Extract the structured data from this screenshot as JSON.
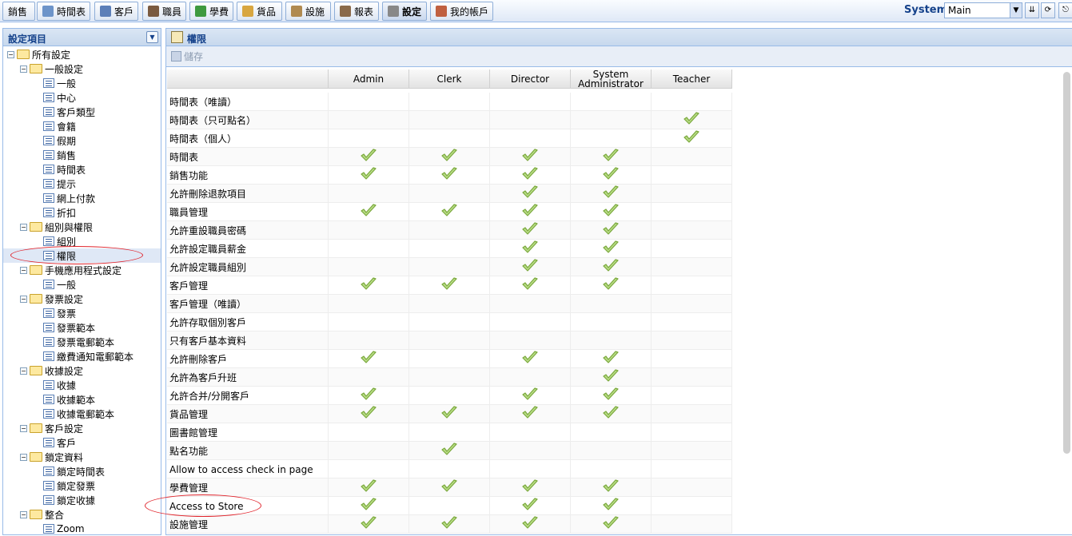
{
  "toolbar": {
    "tabs": [
      {
        "label": "銷售",
        "icon": "sales-icon"
      },
      {
        "label": "時間表",
        "icon": "calendar-icon"
      },
      {
        "label": "客戶",
        "icon": "user-icon"
      },
      {
        "label": "職員",
        "icon": "staff-icon"
      },
      {
        "label": "學費",
        "icon": "dollar-icon"
      },
      {
        "label": "貨品",
        "icon": "box-icon"
      },
      {
        "label": "設施",
        "icon": "house-icon"
      },
      {
        "label": "報表",
        "icon": "report-icon"
      },
      {
        "label": "設定",
        "icon": "gear-icon"
      },
      {
        "label": "我的帳戶",
        "icon": "account-icon"
      }
    ],
    "system_label": "System",
    "system_value": "Main"
  },
  "left": {
    "title": "設定項目",
    "tree": [
      {
        "label": "所有設定",
        "type": "folder",
        "level": 0
      },
      {
        "label": "一般設定",
        "type": "folder",
        "level": 1
      },
      {
        "label": "一般",
        "type": "leaf",
        "level": 2
      },
      {
        "label": "中心",
        "type": "leaf",
        "level": 2
      },
      {
        "label": "客戶類型",
        "type": "leaf",
        "level": 2
      },
      {
        "label": "會籍",
        "type": "leaf",
        "level": 2
      },
      {
        "label": "假期",
        "type": "leaf",
        "level": 2
      },
      {
        "label": "銷售",
        "type": "leaf",
        "level": 2
      },
      {
        "label": "時間表",
        "type": "leaf",
        "level": 2
      },
      {
        "label": "提示",
        "type": "leaf",
        "level": 2
      },
      {
        "label": "網上付款",
        "type": "leaf",
        "level": 2
      },
      {
        "label": "折扣",
        "type": "leaf",
        "level": 2
      },
      {
        "label": "組別與權限",
        "type": "folder",
        "level": 1
      },
      {
        "label": "組別",
        "type": "leaf",
        "level": 2
      },
      {
        "label": "權限",
        "type": "leaf",
        "level": 2,
        "selected": true
      },
      {
        "label": "手機應用程式設定",
        "type": "folder",
        "level": 1
      },
      {
        "label": "一般",
        "type": "leaf",
        "level": 2
      },
      {
        "label": "發票設定",
        "type": "folder",
        "level": 1
      },
      {
        "label": "發票",
        "type": "leaf",
        "level": 2
      },
      {
        "label": "發票範本",
        "type": "leaf",
        "level": 2
      },
      {
        "label": "發票電郵範本",
        "type": "leaf",
        "level": 2
      },
      {
        "label": "繳費通知電郵範本",
        "type": "leaf",
        "level": 2
      },
      {
        "label": "收據設定",
        "type": "folder",
        "level": 1
      },
      {
        "label": "收據",
        "type": "leaf",
        "level": 2
      },
      {
        "label": "收據範本",
        "type": "leaf",
        "level": 2
      },
      {
        "label": "收據電郵範本",
        "type": "leaf",
        "level": 2
      },
      {
        "label": "客戶設定",
        "type": "folder",
        "level": 1
      },
      {
        "label": "客戶",
        "type": "leaf",
        "level": 2
      },
      {
        "label": "鎖定資料",
        "type": "folder",
        "level": 1
      },
      {
        "label": "鎖定時間表",
        "type": "leaf",
        "level": 2
      },
      {
        "label": "鎖定發票",
        "type": "leaf",
        "level": 2
      },
      {
        "label": "鎖定收據",
        "type": "leaf",
        "level": 2
      },
      {
        "label": "整合",
        "type": "folder",
        "level": 1
      },
      {
        "label": "Zoom",
        "type": "leaf",
        "level": 2
      }
    ]
  },
  "right": {
    "title": "權限",
    "save_label": "儲存",
    "columns": [
      "Admin",
      "Clerk",
      "Director",
      "System\nAdministrator",
      "Teacher"
    ],
    "rows": [
      {
        "label": "時間表（唯讀）",
        "checks": [
          0,
          0,
          0,
          0,
          0
        ]
      },
      {
        "label": "時間表（只可點名）",
        "checks": [
          0,
          0,
          0,
          0,
          1
        ]
      },
      {
        "label": "時間表（個人）",
        "checks": [
          0,
          0,
          0,
          0,
          1
        ]
      },
      {
        "label": "時間表",
        "checks": [
          1,
          1,
          1,
          1,
          0
        ]
      },
      {
        "label": "銷售功能",
        "checks": [
          1,
          1,
          1,
          1,
          0
        ]
      },
      {
        "label": "允許刪除退款項目",
        "checks": [
          0,
          0,
          1,
          1,
          0
        ]
      },
      {
        "label": "職員管理",
        "checks": [
          1,
          1,
          1,
          1,
          0
        ]
      },
      {
        "label": "允許重設職員密碼",
        "checks": [
          0,
          0,
          1,
          1,
          0
        ]
      },
      {
        "label": "允許設定職員薪金",
        "checks": [
          0,
          0,
          1,
          1,
          0
        ]
      },
      {
        "label": "允許設定職員組別",
        "checks": [
          0,
          0,
          1,
          1,
          0
        ]
      },
      {
        "label": "客戶管理",
        "checks": [
          1,
          1,
          1,
          1,
          0
        ]
      },
      {
        "label": "客戶管理（唯讀）",
        "checks": [
          0,
          0,
          0,
          0,
          0
        ]
      },
      {
        "label": "允許存取個別客戶",
        "checks": [
          0,
          0,
          0,
          0,
          0
        ]
      },
      {
        "label": "只有客戶基本資料",
        "checks": [
          0,
          0,
          0,
          0,
          0
        ]
      },
      {
        "label": "允許刪除客戶",
        "checks": [
          1,
          0,
          1,
          1,
          0
        ]
      },
      {
        "label": "允許為客戶升班",
        "checks": [
          0,
          0,
          0,
          1,
          0
        ]
      },
      {
        "label": "允許合并/分開客戶",
        "checks": [
          1,
          0,
          1,
          1,
          0
        ]
      },
      {
        "label": "貨品管理",
        "checks": [
          1,
          1,
          1,
          1,
          0
        ]
      },
      {
        "label": "圖書館管理",
        "checks": [
          0,
          0,
          0,
          0,
          0
        ]
      },
      {
        "label": "點名功能",
        "checks": [
          0,
          1,
          0,
          0,
          0
        ]
      },
      {
        "label": "Allow to access check in page",
        "checks": [
          0,
          0,
          0,
          0,
          0
        ]
      },
      {
        "label": "學費管理",
        "checks": [
          1,
          1,
          1,
          1,
          0
        ]
      },
      {
        "label": "Access to Store",
        "checks": [
          1,
          0,
          1,
          1,
          0
        ]
      },
      {
        "label": "設施管理",
        "checks": [
          1,
          1,
          1,
          1,
          0
        ]
      }
    ]
  },
  "colors": {
    "accent": "#15428b",
    "border": "#99bbe8",
    "check": "#8cc63f",
    "annotation": "#e0232b"
  }
}
